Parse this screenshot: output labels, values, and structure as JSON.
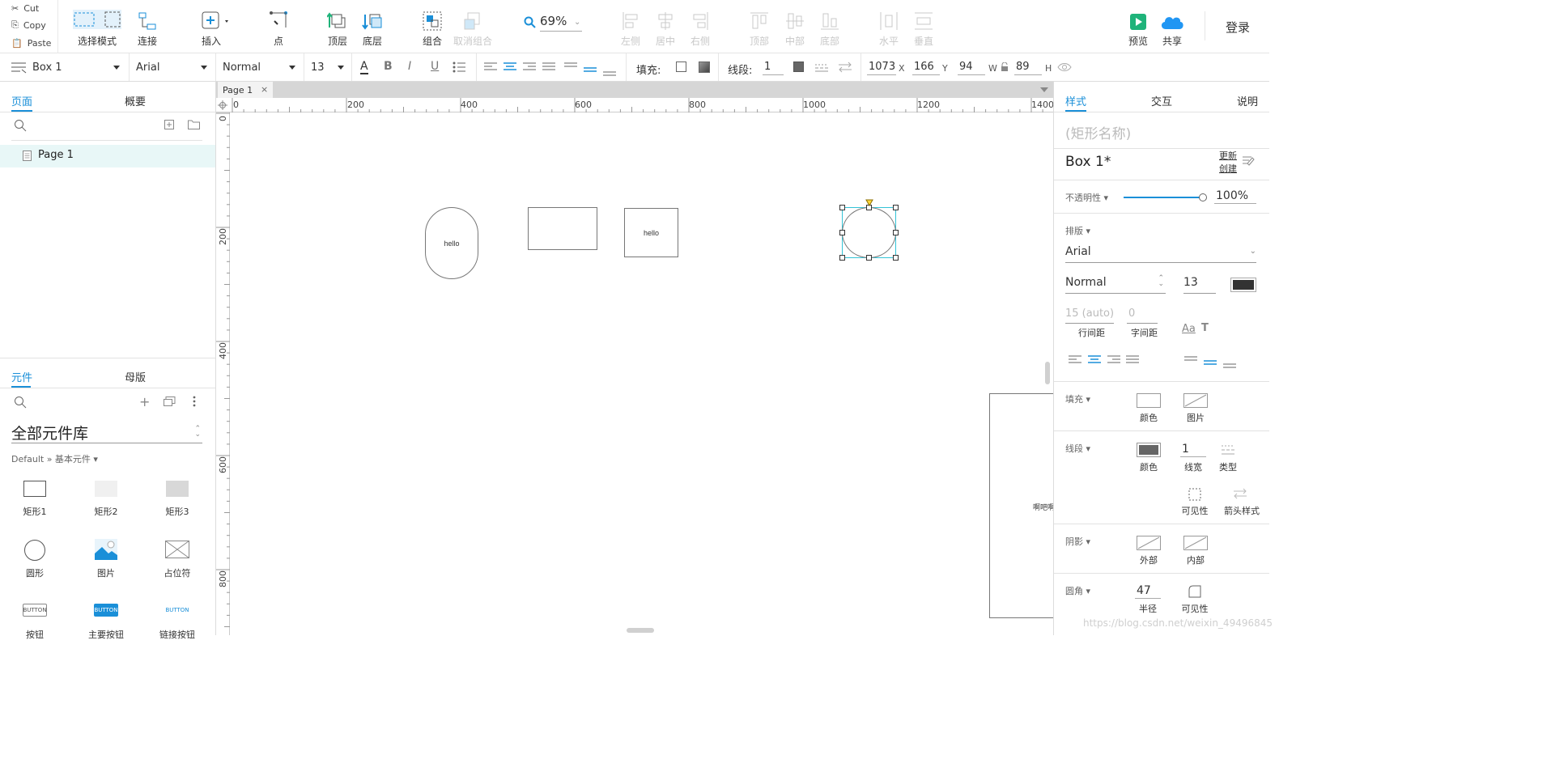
{
  "clipboard": {
    "cut": "Cut",
    "copy": "Copy",
    "paste": "Paste"
  },
  "toolbar": {
    "select_mode": "选择模式",
    "connect": "连接",
    "insert": "插入",
    "point": "点",
    "top_layer": "顶层",
    "bottom_layer": "底层",
    "group": "组合",
    "ungroup": "取消组合",
    "zoom": "69%",
    "align_left": "左侧",
    "align_center": "居中",
    "align_right": "右侧",
    "align_top": "顶部",
    "align_middle": "中部",
    "align_bottom": "底部",
    "dist_horizontal": "水平",
    "dist_vertical": "垂直",
    "preview": "预览",
    "share": "共享",
    "login": "登录"
  },
  "format_bar": {
    "widget_name": "Box 1",
    "font": "Arial",
    "weight": "Normal",
    "size": "13",
    "fill_label": "填充:",
    "stroke_label": "线段:",
    "stroke_width": "1",
    "x": "1073",
    "x_unit": "X",
    "y": "166",
    "y_unit": "Y",
    "w": "94",
    "w_unit": "W",
    "h": "89",
    "h_unit": "H"
  },
  "left_panel": {
    "tabs": [
      "页面",
      "概要"
    ],
    "pages": [
      {
        "label": "Page 1"
      }
    ],
    "lib_tabs": [
      "元件",
      "母版"
    ],
    "library_title": "全部元件库",
    "library_path": "Default » 基本元件 ▾",
    "widgets": [
      {
        "label": "矩形1",
        "icon": "rect-white-icon"
      },
      {
        "label": "矩形2",
        "icon": "rect-light-icon"
      },
      {
        "label": "矩形3",
        "icon": "rect-gray-icon"
      },
      {
        "label": "圆形",
        "icon": "circle-icon"
      },
      {
        "label": "图片",
        "icon": "image-icon"
      },
      {
        "label": "占位符",
        "icon": "placeholder-icon"
      },
      {
        "label": "按钮",
        "icon": "button-icon",
        "text": "BUTTON"
      },
      {
        "label": "主要按钮",
        "icon": "primary-button-icon",
        "text": "BUTTON"
      },
      {
        "label": "链接按钮",
        "icon": "link-button-icon",
        "text": "BUTTON"
      }
    ]
  },
  "canvas": {
    "page_tab": "Page 1",
    "ruler_h": [
      "0",
      "200",
      "400",
      "600",
      "800",
      "1000",
      "1200",
      "1400"
    ],
    "ruler_v": [
      "0",
      "200",
      "400",
      "600",
      "800"
    ],
    "shapes": {
      "pill_text": "hello",
      "box_text": "hello",
      "partial_text": "啊吧啊"
    }
  },
  "right_panel": {
    "tabs": [
      "样式",
      "交互",
      "说明"
    ],
    "shape_name_placeholder": "(矩形名称)",
    "style_name": "Box 1*",
    "update_label": "更新",
    "create_label": "创建",
    "opacity_label": "不透明性 ▾",
    "opacity_value": "100%",
    "opacity_fraction": 1.0,
    "typography_label": "排版 ▾",
    "font": "Arial",
    "weight": "Normal",
    "size": "13",
    "text_color": "#333333",
    "line_height_value": "15 (auto)",
    "line_height_label": "行间距",
    "letter_spacing_value": "0",
    "letter_spacing_label": "字间距",
    "fill_label": "填充 ▾",
    "fill_color": "颜色",
    "fill_image": "图片",
    "stroke_label": "线段 ▾",
    "stroke_color": "颜色",
    "stroke_width_value": "1",
    "stroke_width_label": "线宽",
    "stroke_type": "类型",
    "visibility": "可见性",
    "arrow_style": "箭头样式",
    "shadow_label": "阴影 ▾",
    "shadow_outer": "外部",
    "shadow_inner": "内部",
    "radius_label": "圆角 ▾",
    "radius_value": "47",
    "radius_caption": "半径",
    "radius_visibility": "可见性"
  },
  "watermark": "https://blog.csdn.net/weixin_49496845",
  "colors": {
    "accent": "#1a8fd8",
    "selection": "#33c3d6",
    "preview_green": "#1fb37a",
    "share_blue": "#2196f3"
  }
}
